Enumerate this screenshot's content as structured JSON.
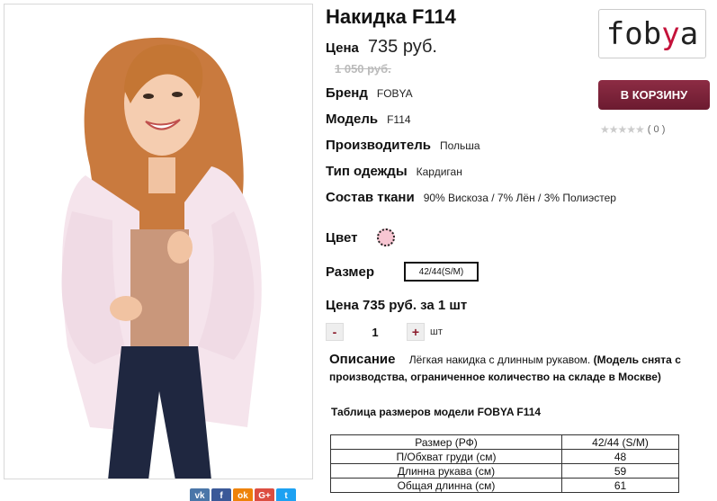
{
  "product": {
    "title": "Накидка F114",
    "price_label": "Цена",
    "price": "735 руб.",
    "old_price": "1 050 руб."
  },
  "attributes": [
    {
      "label": "Бренд",
      "value": "FOBYA"
    },
    {
      "label": "Модель",
      "value": "F114"
    },
    {
      "label": "Производитель",
      "value": "Польша"
    },
    {
      "label": "Тип одежды",
      "value": "Кардиган"
    },
    {
      "label": "Состав ткани",
      "value": "90% Вискоза / 7% Лён / 3% Полиэстер"
    }
  ],
  "color": {
    "label": "Цвет",
    "swatch": "#f7c6d2"
  },
  "size": {
    "label": "Размер",
    "value": "42/44(S/M)"
  },
  "total": "Цена 735 руб. за 1 шт",
  "quantity": {
    "minus": "-",
    "value": "1",
    "plus": "+",
    "unit": "шт"
  },
  "description": {
    "label": "Описание",
    "text": "Лёгкая накидка с длинным рукавом.",
    "note": "(Модель снята с производства, ограниченное количество на складе в Москве)"
  },
  "size_table": {
    "title": "Таблица размеров модели FOBYA F114",
    "rows": [
      [
        "Размер (РФ)",
        "42/44 (S/M)"
      ],
      [
        "П/Обхват груди (см)",
        "48"
      ],
      [
        "Длинна рукава (см)",
        "59"
      ],
      [
        "Общая длинна (см)",
        "61"
      ]
    ]
  },
  "brand_logo": {
    "text_a": "fob",
    "text_b": "y",
    "text_c": "a"
  },
  "cart_button": "В КОРЗИНУ",
  "rating": {
    "stars": "★★★★★",
    "count": "( 0 )"
  },
  "share": {
    "vk": "vk",
    "fb": "f",
    "ok": "ok",
    "gp": "G+",
    "tw": "t"
  },
  "colors": {
    "accent": "#8d2c44",
    "logo_accent": "#c4123a"
  }
}
